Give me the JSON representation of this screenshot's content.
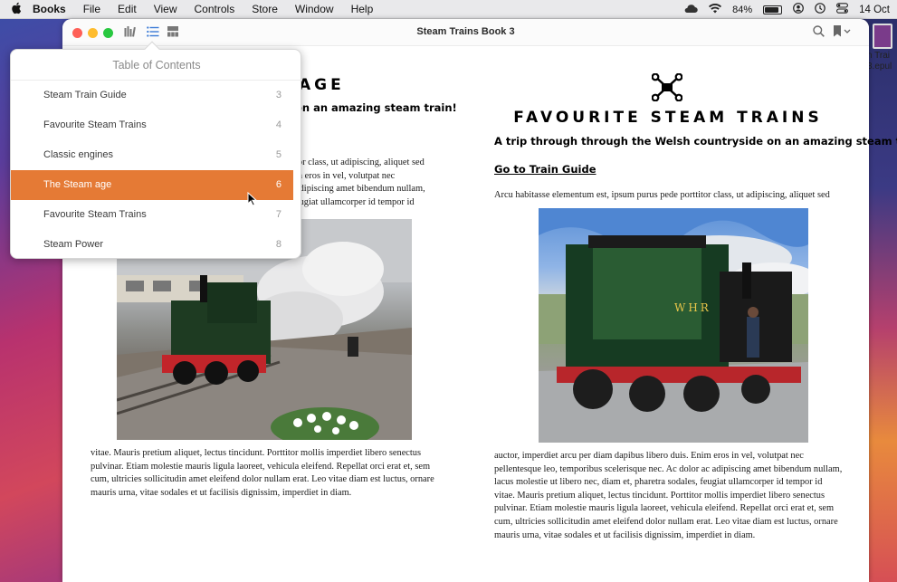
{
  "menubar": {
    "app_name": "Books",
    "items": [
      "File",
      "Edit",
      "View",
      "Controls",
      "Store",
      "Window",
      "Help"
    ],
    "battery_percent": "84%",
    "date": "14 Oct"
  },
  "window": {
    "title": "Steam Trains Book 3"
  },
  "desktop": {
    "file_label_line1": "n Trai",
    "file_label_line2": "3.epul"
  },
  "toc": {
    "header": "Table of Contents",
    "items": [
      {
        "label": "Steam Train Guide",
        "page": "3"
      },
      {
        "label": "Favourite Steam Trains",
        "page": "4"
      },
      {
        "label": "Classic engines",
        "page": "5"
      },
      {
        "label": "The Steam age",
        "page": "6"
      },
      {
        "label": "Favourite Steam Trains",
        "page": "7"
      },
      {
        "label": "Steam Power",
        "page": "8"
      }
    ],
    "active_index": 3
  },
  "left_page": {
    "title_fragment": "AGE",
    "subtitle_fragment": "on an amazing steam train!",
    "para1_lines": [
      "tor class, ut adipiscing, aliquet sed",
      "m eros in vel, volutpat nec",
      "adipiscing amet bibendum nullam,",
      "eugiat ullamcorper id tempor id"
    ],
    "para2_lines": [
      "vitae. Mauris pretium aliquet, lectus tincidunt. Porttitor mollis imperdiet libero senectus",
      "pulvinar. Etiam molestie mauris ligula laoreet, vehicula eleifend. Repellat orci erat et, sem",
      "cum, ultricies sollicitudin amet eleifend dolor nullam erat. Leo vitae diam est luctus, ornare",
      "mauris urna, vitae sodales et ut facilisis dignissim, imperdiet in diam."
    ]
  },
  "right_page": {
    "title": "FAVOURITE STEAM TRAINS",
    "subtitle": "A trip through through the Welsh countryside on an amazing steam train!",
    "link": "Go to Train Guide",
    "intro": "Arcu habitasse elementum est, ipsum purus pede porttitor class, ut adipiscing, aliquet sed",
    "photo_text": "WHR",
    "para_lines": [
      "auctor, imperdiet arcu per diam dapibus libero duis. Enim eros in vel, volutpat nec",
      "pellentesque leo, temporibus scelerisque nec. Ac dolor ac adipiscing amet bibendum nullam,",
      "lacus molestie ut libero nec, diam et, pharetra sodales, feugiat ullamcorper id tempor id",
      "vitae. Mauris pretium aliquet, lectus tincidunt. Porttitor mollis imperdiet libero senectus",
      "pulvinar. Etiam molestie mauris ligula laoreet, vehicula eleifend. Repellat orci erat et, sem",
      "cum, ultricies sollicitudin amet eleifend dolor nullam erat. Leo vitae diam est luctus, ornare",
      "mauris urna, vitae sodales et ut facilisis dignissim, imperdiet in diam."
    ]
  },
  "colors": {
    "accent": "#e57a35",
    "close": "#fe5f57",
    "minimize": "#febc2e",
    "zoom": "#28c840"
  },
  "icons": [
    "apple-icon",
    "library-icon",
    "toc-list-icon",
    "thumbnails-icon",
    "search-icon",
    "bookmark-icon",
    "chapter-logo-icon",
    "wifi-icon",
    "cloud-icon",
    "user-icon",
    "time-machine-icon",
    "control-center-icon",
    "pointer-cursor-icon"
  ]
}
